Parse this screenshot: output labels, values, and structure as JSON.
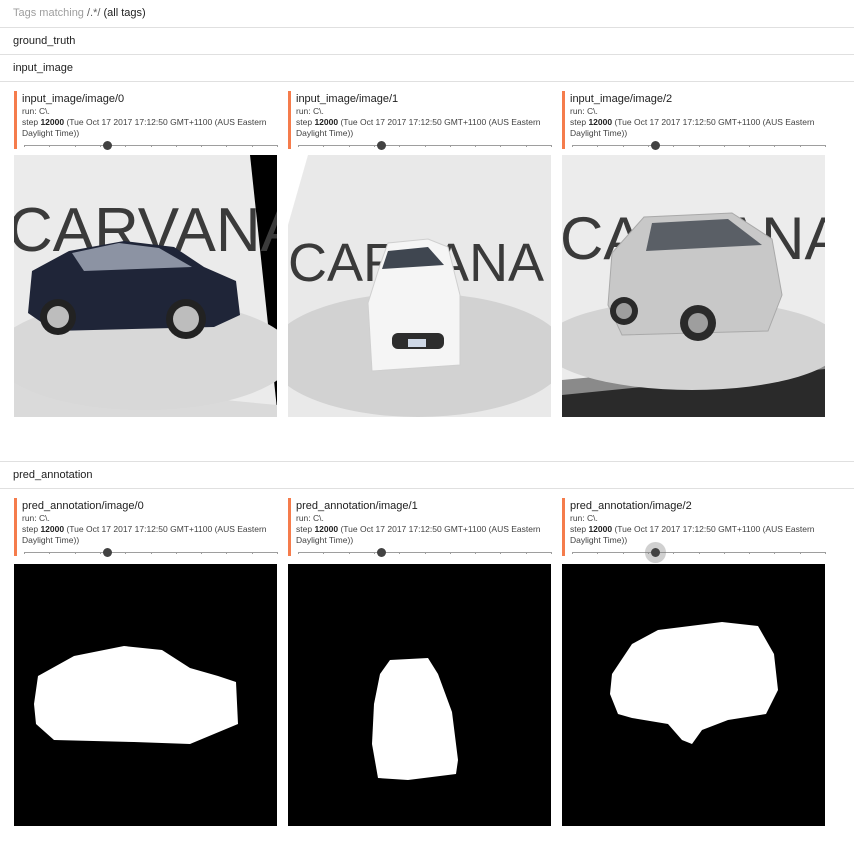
{
  "header": {
    "prefix": "Tags matching ",
    "pattern": "/.*/",
    "suffix": "(all tags)"
  },
  "categories": {
    "ground_truth": "ground_truth",
    "input_image": "input_image",
    "pred_annotation": "pred_annotation"
  },
  "input_cards": [
    {
      "title": "input_image/image/0",
      "run": "run: C\\.",
      "step_prefix": "step ",
      "step": "12000",
      "time": " (Tue Oct 17 2017 17:12:50 GMT+1100 (AUS Eastern Daylight Time))",
      "logo": "CARVANA"
    },
    {
      "title": "input_image/image/1",
      "run": "run: C\\.",
      "step_prefix": "step ",
      "step": "12000",
      "time": " (Tue Oct 17 2017 17:12:50 GMT+1100 (AUS Eastern Daylight Time))",
      "logo": "CARVANA"
    },
    {
      "title": "input_image/image/2",
      "run": "run: C\\.",
      "step_prefix": "step ",
      "step": "12000",
      "time": " (Tue Oct 17 2017 17:12:50 GMT+1100 (AUS Eastern Daylight Time))",
      "logo": "CARVANA"
    }
  ],
  "pred_cards": [
    {
      "title": "pred_annotation/image/0",
      "run": "run: C\\.",
      "step_prefix": "step ",
      "step": "12000",
      "time": " (Tue Oct 17 2017 17:12:50 GMT+1100 (AUS Eastern Daylight Time))"
    },
    {
      "title": "pred_annotation/image/1",
      "run": "run: C\\.",
      "step_prefix": "step ",
      "step": "12000",
      "time": " (Tue Oct 17 2017 17:12:50 GMT+1100 (AUS Eastern Daylight Time))"
    },
    {
      "title": "pred_annotation/image/2",
      "run": "run: C\\.",
      "step_prefix": "step ",
      "step": "12000",
      "time": " (Tue Oct 17 2017 17:12:50 GMT+1100 (AUS Eastern Daylight Time))"
    }
  ],
  "colors": {
    "accent": "#f57c4c",
    "slider_knob": "#424242",
    "divider": "#e0e0e0"
  }
}
